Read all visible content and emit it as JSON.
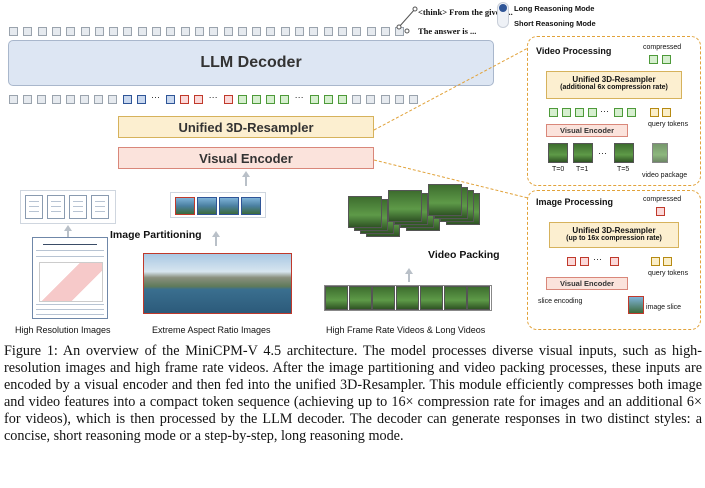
{
  "reasoning": {
    "think_text": "<think> From the given ...",
    "answer_text": "The answer is ...",
    "long_mode": "Long Reasoning Mode",
    "short_mode": "Short Reasoning Mode"
  },
  "main": {
    "decoder": "LLM Decoder",
    "resampler": "Unified 3D-Resampler",
    "encoder": "Visual Encoder",
    "ellipsis": "···"
  },
  "inputs": {
    "image_partitioning": "Image Partitioning",
    "video_packing": "Video Packing",
    "high_res": "High Resolution Images",
    "extreme_ratio": "Extreme Aspect Ratio Images",
    "high_fps": "High Frame Rate Videos & Long Videos"
  },
  "video_panel": {
    "title": "Video Processing",
    "compressed": "compressed",
    "resampler": "Unified 3D-Resampler",
    "resampler_sub": "(additional 6x compression rate)",
    "query_tokens": "query tokens",
    "encoder": "Visual Encoder",
    "t0": "T=0",
    "t1": "T=1",
    "t5": "T=5",
    "video_package": "video package"
  },
  "image_panel": {
    "title": "Image Processing",
    "compressed": "compressed",
    "resampler": "Unified 3D-Resampler",
    "resampler_sub": "(up to 16x compression rate)",
    "query_tokens": "query tokens",
    "encoder": "Visual Encoder",
    "slice_encoding": "slice encoding",
    "image_slice": "image slice"
  },
  "caption": "Figure 1: An overview of the MiniCPM-V 4.5 architecture. The model processes diverse visual inputs, such as high-resolution images and high frame rate videos. After the image partitioning and video packing processes, these inputs are encoded by a visual encoder and then fed into the unified 3D-Resampler. This module efficiently compresses both image and video features into a compact token sequence (achieving up to 16× compression rate for images and an additional 6× for videos), which is then processed by the LLM decoder. The decoder can generate responses in two distinct styles: a concise, short reasoning mode or a step-by-step, long reasoning mode.",
  "colors": {
    "decoder_fill": "#dde6f3",
    "resampler_fill": "#fcefd0",
    "encoder_fill": "#fbe3dc",
    "panel_border": "#e1a23a"
  }
}
